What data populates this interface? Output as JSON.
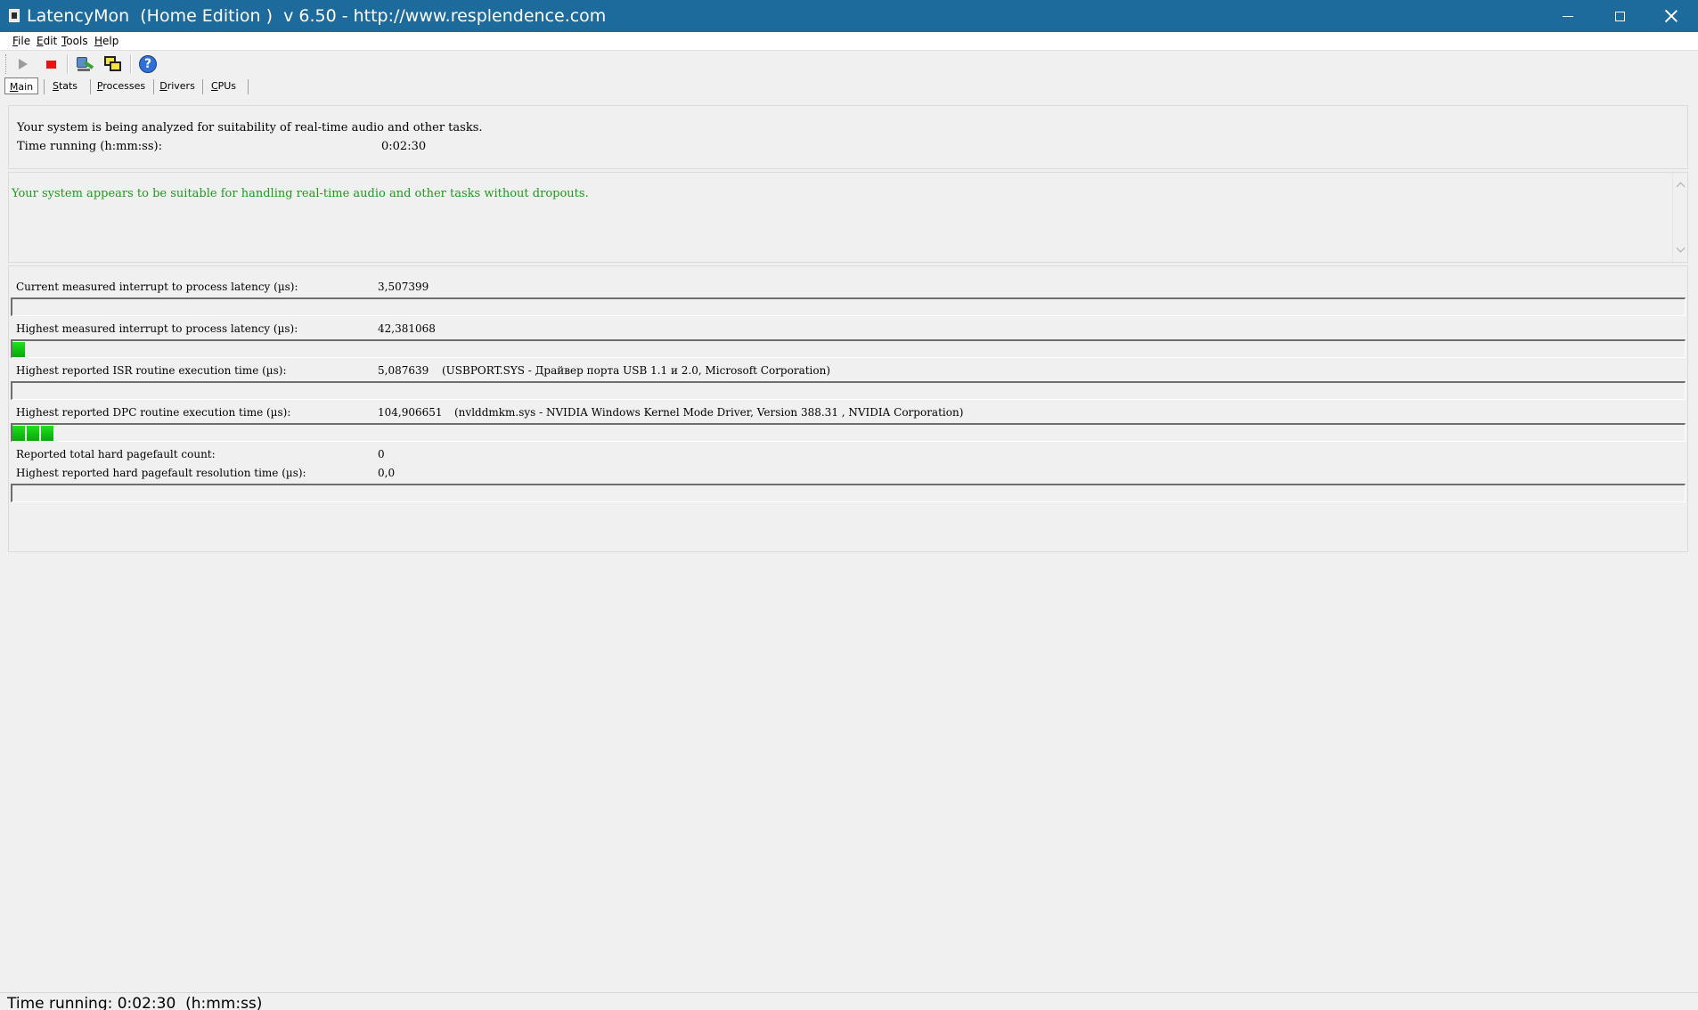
{
  "window": {
    "title": "LatencyMon  (Home Edition )  v 6.50 - http://www.resplendence.com",
    "accent_color": "#1d6b9c"
  },
  "menu": {
    "items": [
      "File",
      "Edit",
      "Tools",
      "Help"
    ]
  },
  "toolbar": {
    "buttons": [
      "play-icon",
      "stop-icon",
      "analyze-icon",
      "window-icon",
      "help-icon"
    ]
  },
  "tabs": {
    "items": [
      "Main",
      "Stats",
      "Processes",
      "Drivers",
      "CPUs"
    ],
    "active": "Main"
  },
  "analysis": {
    "line1": "Your system is being analyzed for suitability of real-time audio and other tasks.",
    "time_label": "Time running (h:mm:ss):",
    "time_value": "0:02:30"
  },
  "verdict": {
    "text": "Your system appears to be suitable for handling real-time audio and other tasks without dropouts.",
    "color": "#1e9a1e"
  },
  "metrics": {
    "current_latency": {
      "label": "Current measured interrupt to process latency (µs):",
      "value": "3,507399",
      "segments": 0
    },
    "highest_latency": {
      "label": "Highest measured interrupt to process latency (µs):",
      "value": "42,381068",
      "segments": 1
    },
    "isr": {
      "label": "Highest reported ISR routine execution time (µs):",
      "value": "5,087639",
      "detail": "(USBPORT.SYS - Драйвер порта USB 1.1 и 2.0, Microsoft Corporation)",
      "segments": 0
    },
    "dpc": {
      "label": "Highest reported DPC routine execution time (µs):",
      "value": "104,906651",
      "detail": "(nvlddmkm.sys - NVIDIA Windows Kernel Mode Driver, Version 388.31 , NVIDIA Corporation)",
      "segments": 3
    },
    "pagefault_count": {
      "label": "Reported total hard pagefault count:",
      "value": "0"
    },
    "pagefault_time": {
      "label": "Highest reported hard pagefault resolution time (µs):",
      "value": "0,0",
      "segments": 0
    }
  },
  "status": {
    "text": "Time running: 0:02:30  (h:mm:ss)"
  }
}
